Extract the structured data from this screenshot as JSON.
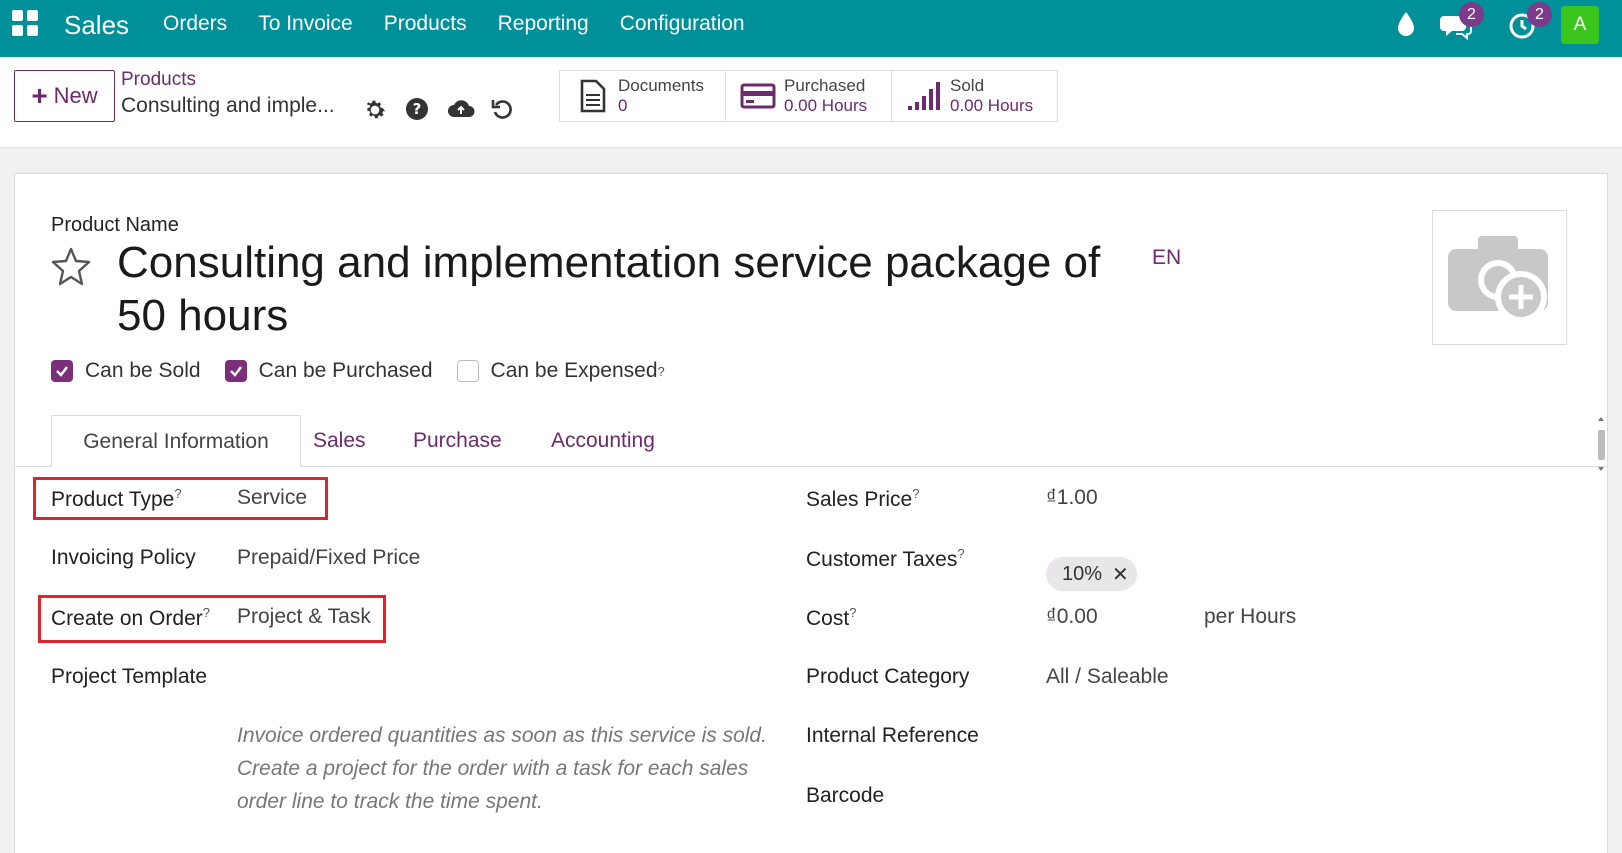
{
  "topbar": {
    "app_name": "Sales",
    "menu": [
      "Orders",
      "To Invoice",
      "Products",
      "Reporting",
      "Configuration"
    ],
    "messages_count": "2",
    "activities_count": "2",
    "avatar_letter": "A",
    "colors": {
      "bar": "#00909a",
      "badge": "#7b3b8a",
      "avatar": "#39c51b"
    }
  },
  "control": {
    "new_label": "New",
    "breadcrumb_parent": "Products",
    "breadcrumb_current": "Consulting and imple...",
    "smart_buttons": [
      {
        "label": "Documents",
        "value": "0",
        "icon": "document-icon"
      },
      {
        "label": "Purchased",
        "value": "0.00 Hours",
        "icon": "credit-card-icon"
      },
      {
        "label": "Sold",
        "value": "0.00 Hours",
        "icon": "signal-bars-icon"
      }
    ]
  },
  "form": {
    "name_label": "Product Name",
    "name": "Consulting and implementation service package of 50 hours",
    "lang": "EN",
    "checkboxes": [
      {
        "label": "Can be Sold",
        "checked": true
      },
      {
        "label": "Can be Purchased",
        "checked": true
      },
      {
        "label": "Can be Expensed",
        "checked": false,
        "help": "?"
      }
    ],
    "tabs": [
      "General Information",
      "Sales",
      "Purchase",
      "Accounting"
    ],
    "active_tab": "General Information",
    "left_fields": [
      {
        "label": "Product Type",
        "help": "?",
        "value": "Service"
      },
      {
        "label": "Invoicing Policy",
        "value": "Prepaid/Fixed Price"
      },
      {
        "label": "Create on Order",
        "help": "?",
        "value": "Project & Task"
      },
      {
        "label": "Project Template",
        "value": ""
      }
    ],
    "help_text": "Invoice ordered quantities as soon as this service is sold. Create a project for the order with a task for each sales order line to track the time spent.",
    "right_fields": [
      {
        "label": "Sales Price",
        "help": "?",
        "value": "₫1.00"
      },
      {
        "label": "Customer Taxes",
        "help": "?",
        "value": "10%"
      },
      {
        "label": "Cost",
        "help": "?",
        "value": "₫0.00",
        "suffix": "per Hours"
      },
      {
        "label": "Product Category",
        "value": "All / Saleable"
      },
      {
        "label": "Internal Reference",
        "value": ""
      },
      {
        "label": "Barcode",
        "value": ""
      }
    ],
    "accent_color": "#6d2a6d",
    "highlight_color": "#e0242e"
  }
}
